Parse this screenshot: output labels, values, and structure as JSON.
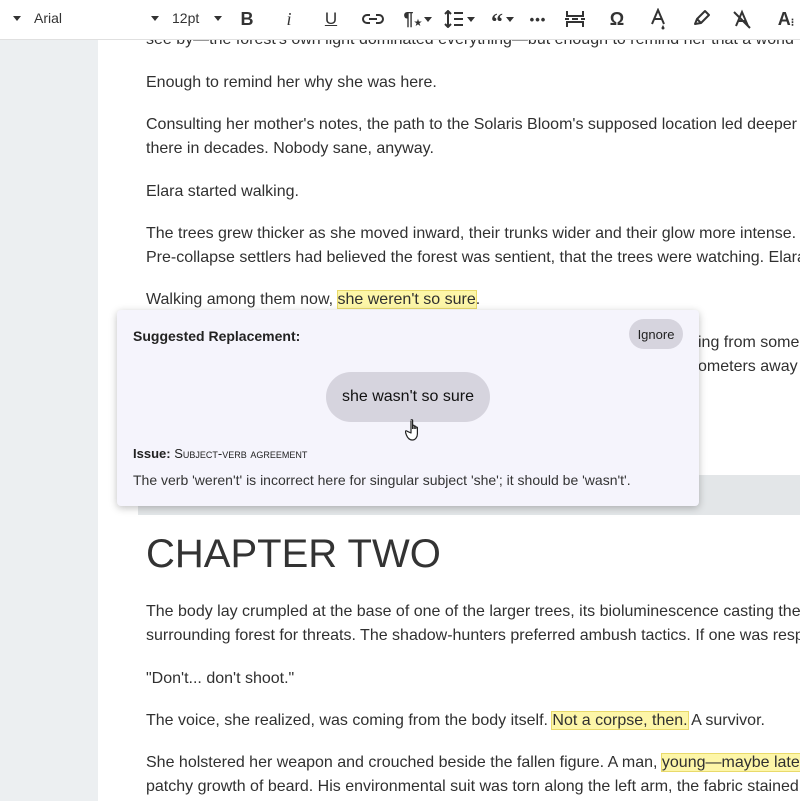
{
  "toolbar": {
    "font_family": "Arial",
    "font_size": "12pt",
    "icons": [
      "caret-down-icon",
      "bold-icon",
      "italic-icon",
      "underline-icon",
      "link-icon",
      "paragraph-style-icon",
      "line-spacing-icon",
      "blockquote-icon",
      "horizontal-rule-icon",
      "page-break-icon",
      "special-character-icon",
      "text-color-icon",
      "highlight-icon",
      "clear-formatting-icon",
      "text-size-icon"
    ]
  },
  "document": {
    "line_top_partial": "see by—the forest's own light dominated everything—but enough to remind her that a world",
    "p1": "Enough to remind her why she was here.",
    "p2_line1": "Consulting her mother's notes, the path to the Solaris Bloom's supposed location led deeper",
    "p2_line2": "there in decades. Nobody sane, anyway.",
    "p3": "Elara started walking.",
    "p4_line1": "The trees grew thicker as she moved inward, their trunks wider and their glow more intense.",
    "p4_line2": "Pre-collapse settlers had believed the forest was sentient, that the trees were watching. Elara",
    "p5_prefix": "Walking among them now, ",
    "p5_highlight": "she weren't so sure",
    "p5_suffix": ".",
    "hidden_line1_tail": "ing from some",
    "hidden_line2_tail": "ometers away f",
    "chapter_heading": "CHAPTER TWO",
    "c1_line1": "The body lay crumpled at the base of one of the larger trees, its bioluminescence casting the",
    "c1_line2": "surrounding forest for threats. The shadow-hunters preferred ambush tactics. If one was resp",
    "c2": "\"Don't... don't shoot.\"",
    "c3_prefix": "The voice, she realized, was coming from the body itself. ",
    "c3_highlight": "Not a corpse, then.",
    "c3_suffix": " A survivor.",
    "c4_line1_prefix": "She holstered her weapon and crouched beside the fallen figure. A man, ",
    "c4_line1_highlight": "young—maybe late",
    "c4_line2": "patchy growth of beard. His environmental suit was torn along the left arm, the fabric stained"
  },
  "suggestion": {
    "title": "Suggested Replacement:",
    "ignore_label": "Ignore",
    "replacement": "she wasn't so sure",
    "issue_label": "Issue:",
    "issue_type": "Subject-verb agreement",
    "description": "The verb 'weren't' is incorrect here for singular subject 'she'; it should be 'wasn't'."
  },
  "colors": {
    "highlight": "#fdf6a8",
    "popup_bg": "#f5f4fc",
    "pill_bg": "#d6d4de",
    "sidebar_bg": "#eceff1"
  }
}
